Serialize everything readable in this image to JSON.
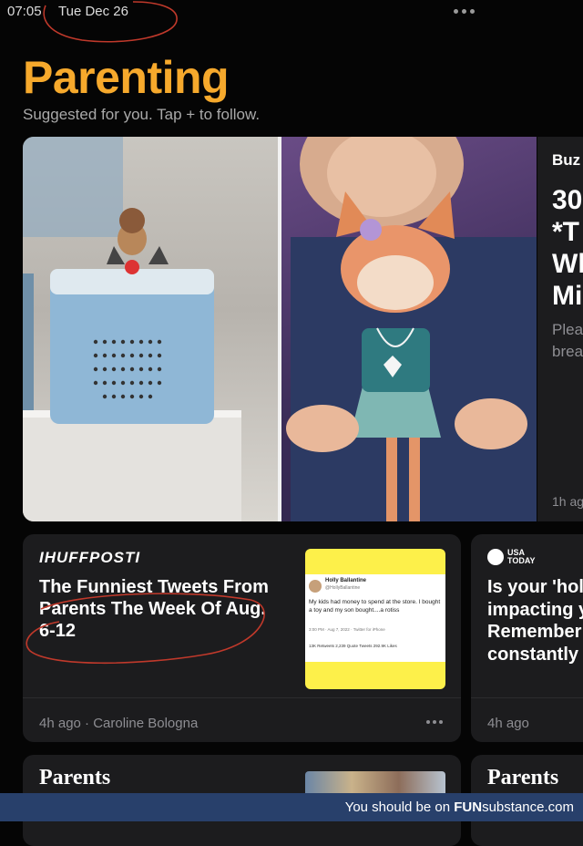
{
  "status": {
    "time": "07:05",
    "date": "Tue Dec 26"
  },
  "header": {
    "title": "Parenting",
    "subtitle": "Suggested for you. Tap + to follow."
  },
  "side_card": {
    "source": "Buz",
    "headline": "30\n*T\nWl\nMi",
    "summary": "Plea\nbrea",
    "time": "1h ag"
  },
  "huffpost_card": {
    "source": "IHUFFPOSTI",
    "headline": "The Funniest Tweets From Parents The Week Of Aug. 6-12",
    "footer": "4h ago · Caroline Bologna",
    "tweet": {
      "name": "Holly Ballantine",
      "handle": "@HollyBallantine",
      "text": "My kids had money to spend at the store. I bought a toy and my son bought....a rotiss",
      "meta": "3:00 PM · Aug 7, 2022 · Twitter for iPhone",
      "stats": "13K Retweets    2,239 Quote Tweets    292.9K Likes"
    }
  },
  "usatoday_card": {
    "source": "USA\nTODAY",
    "headline": "Is your 'holi\nimpacting y\nRemember\nconstantly",
    "footer": "4h ago"
  },
  "parents_cards": [
    {
      "source": "Parents"
    },
    {
      "source": "Parents"
    }
  ],
  "banner": {
    "prefix": "You should be on ",
    "brand_fun": "FUN",
    "brand_rest": "substance",
    "suffix": ".com"
  },
  "colors": {
    "title": "#f6a92c",
    "background": "#050505",
    "card": "#1c1c1e",
    "banner": "#28406b",
    "scribble": "#c0392b"
  }
}
